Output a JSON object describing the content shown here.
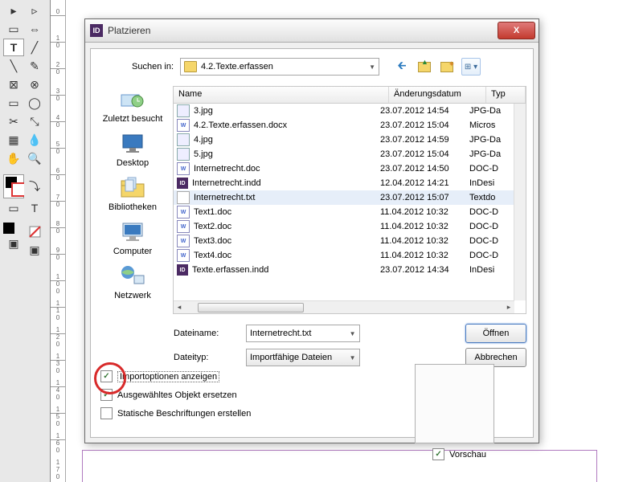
{
  "dialog": {
    "title": "Platzieren",
    "lookin_label": "Suchen in:",
    "folder_name": "4.2.Texte.erfassen",
    "places": {
      "recent": "Zuletzt besucht",
      "desktop": "Desktop",
      "libraries": "Bibliotheken",
      "computer": "Computer",
      "network": "Netzwerk"
    },
    "columns": {
      "name": "Name",
      "date": "Änderungsdatum",
      "type": "Typ"
    },
    "files": [
      {
        "icon": "img",
        "name": "3.jpg",
        "date": "23.07.2012 14:54",
        "type": "JPG-Da"
      },
      {
        "icon": "doc",
        "name": "4.2.Texte.erfassen.docx",
        "date": "23.07.2012 15:04",
        "type": "Micros"
      },
      {
        "icon": "img",
        "name": "4.jpg",
        "date": "23.07.2012 14:59",
        "type": "JPG-Da"
      },
      {
        "icon": "img",
        "name": "5.jpg",
        "date": "23.07.2012 15:04",
        "type": "JPG-Da"
      },
      {
        "icon": "doc",
        "name": "Internetrecht.doc",
        "date": "23.07.2012 14:50",
        "type": "DOC-D"
      },
      {
        "icon": "indd",
        "name": "Internetrecht.indd",
        "date": "12.04.2012 14:21",
        "type": "InDesi"
      },
      {
        "icon": "txt",
        "name": "Internetrecht.txt",
        "date": "23.07.2012 15:07",
        "type": "Textdo",
        "sel": true
      },
      {
        "icon": "doc",
        "name": "Text1.doc",
        "date": "11.04.2012 10:32",
        "type": "DOC-D"
      },
      {
        "icon": "doc",
        "name": "Text2.doc",
        "date": "11.04.2012 10:32",
        "type": "DOC-D"
      },
      {
        "icon": "doc",
        "name": "Text3.doc",
        "date": "11.04.2012 10:32",
        "type": "DOC-D"
      },
      {
        "icon": "doc",
        "name": "Text4.doc",
        "date": "11.04.2012 10:32",
        "type": "DOC-D"
      },
      {
        "icon": "indd",
        "name": "Texte.erfassen.indd",
        "date": "23.07.2012 14:34",
        "type": "InDesi"
      }
    ],
    "filename_label": "Dateiname:",
    "filename_value": "Internetrecht.txt",
    "filetype_label": "Dateityp:",
    "filetype_value": "Importfähige Dateien",
    "open": "Öffnen",
    "cancel": "Abbrechen",
    "chk_import": "Importoptionen anzeigen",
    "chk_replace": "Ausgewähltes Objekt ersetzen",
    "chk_captions": "Statische Beschriftungen erstellen",
    "preview": "Vorschau"
  },
  "ruler_ticks": [
    "0",
    "1 0",
    "2 0",
    "3 0",
    "4 0",
    "5 0",
    "6 0",
    "7 0",
    "8 0",
    "9 0",
    "1 0 0",
    "1 1 0",
    "1 2 0",
    "1 3 0",
    "1 4 0",
    "1 5 0",
    "1 6 0",
    "1 7 0"
  ]
}
